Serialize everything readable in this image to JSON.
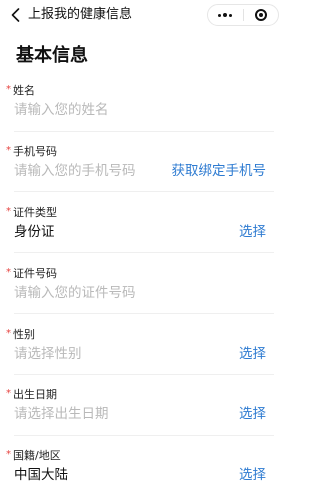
{
  "nav": {
    "title": "上报我的健康信息",
    "back_icon": "chevron-left-icon",
    "more_icon": "more-dots-icon",
    "close_icon": "target-icon"
  },
  "page_title": "基本信息",
  "required_mark": "*",
  "fields": [
    {
      "label": "姓名",
      "value": "请输入您的姓名",
      "is_placeholder": true,
      "action": ""
    },
    {
      "label": "手机号码",
      "value": "请输入您的手机号码",
      "is_placeholder": true,
      "action": "获取绑定手机号"
    },
    {
      "label": "证件类型",
      "value": "身份证",
      "is_placeholder": false,
      "action": "选择"
    },
    {
      "label": "证件号码",
      "value": "请输入您的证件号码",
      "is_placeholder": true,
      "action": ""
    },
    {
      "label": "性别",
      "value": "请选择性别",
      "is_placeholder": true,
      "action": "选择"
    },
    {
      "label": "出生日期",
      "value": "请选择出生日期",
      "is_placeholder": true,
      "action": "选择"
    },
    {
      "label": "国籍/地区",
      "value": "中国大陆",
      "is_placeholder": false,
      "action": "选择"
    }
  ],
  "colors": {
    "required": "#e64340",
    "action": "#2e7bd1",
    "placeholder": "#b9b9b9",
    "text": "#111111",
    "divider": "#efefef"
  }
}
